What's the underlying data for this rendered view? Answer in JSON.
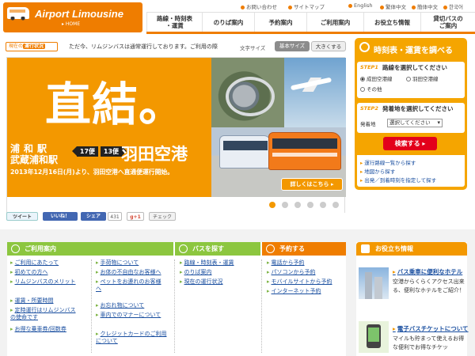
{
  "header": {
    "logo": {
      "name": "Airport Limousine",
      "home": "▸ HOME"
    },
    "utility": [
      {
        "label": "お問い合わせ"
      },
      {
        "label": "サイトマップ"
      },
      {
        "label": "English"
      },
      {
        "label": "繁体中文"
      },
      {
        "label": "簡体中文"
      },
      {
        "label": "한국어"
      }
    ],
    "nav": [
      {
        "label": "路線・時刻表\n・運賃"
      },
      {
        "label": "のりば案内"
      },
      {
        "label": "予約案内"
      },
      {
        "label": "ご利用案内"
      },
      {
        "label": "お役立ち情報"
      },
      {
        "label": "貸切バスの\nご案内"
      }
    ]
  },
  "ticker": {
    "label_prefix": "現在の",
    "label_highlight": "運行状況",
    "message": "ただ今、リムジンバスは通常運行しております。ご利用の際",
    "font_size_label": "文字サイズ",
    "font_basic": "基本サイズ",
    "font_large": "大きくする"
  },
  "hero": {
    "headline": "直結。",
    "from_line1": "浦和駅",
    "from_line2": "武蔵浦和駅",
    "count1": "17便",
    "count2": "13便",
    "destination": "羽田空港",
    "date_note": "2013年12月16日(月)より、羽田空港へ直通便運行開始。",
    "more_button": "詳しくはこちら ▸",
    "slide_count": 6,
    "active_slide": 1
  },
  "panel": {
    "title": "時刻表・運賃を調べる",
    "step1": {
      "step": "STEP1",
      "title": "路線を選択してください",
      "options": [
        "成田空港線",
        "羽田空港線",
        "その他"
      ],
      "selected": "成田空港線"
    },
    "step2": {
      "step": "STEP2",
      "title": "発着地を選択してください",
      "field_label": "発着地",
      "select_value": "選択してください"
    },
    "search_button": "検索する ▸",
    "links": [
      "運行路線一覧から探す",
      "地図から探す",
      "出発／到着時刻を指定して探す"
    ]
  },
  "share": {
    "tweet": "ツイート",
    "like": "いいね！",
    "share": "シェア",
    "share_count": "431",
    "gplus": "g+1",
    "check": "チェック"
  },
  "categories": {
    "guide": {
      "title": "ご利用案内",
      "col1": [
        "ご利用にあたって",
        "初めての方へ",
        "リムジンバスのメリット",
        "",
        "運賃・所要時間",
        "定時運行はリムジンバス\nの使命です",
        "お得な乗車券/回数券"
      ],
      "col2": [
        "手荷物について",
        "お体の不自由なお客様へ",
        "ペットをお連れのお客様\nへ",
        "",
        "お忘れ物について",
        "車内でのマナーについて",
        "",
        "クレジットカードのご利用\nについて"
      ]
    },
    "find_bus": {
      "title": "バスを探す",
      "items": [
        "路線・時刻表・運賃",
        "のりば案内",
        "現在の運行状況"
      ]
    },
    "reserve": {
      "title": "予約する",
      "items": [
        "電話から予約",
        "パソコンから予約",
        "モバイルサイトから予約",
        "インターネット予約"
      ]
    }
  },
  "tips": {
    "title": "お役立ち情報",
    "item1": {
      "title": "バス乗車に便利なホテル",
      "desc": "空港からくらくアクセス出来る、便利なホテルをご紹介！"
    },
    "item2": {
      "title": "電子バスチケットについて",
      "desc": "マイルも貯まって使えるお得な便利でお得なチケッ"
    }
  },
  "colors": {
    "brand_orange": "#ef7d00",
    "hero_orange": "#f39800",
    "panel_yellow": "#f5a500",
    "guide_green": "#8cc63f",
    "reserve_orange": "#ef7d00",
    "search_red": "#e3001b",
    "link_blue": "#1a4fa0"
  }
}
